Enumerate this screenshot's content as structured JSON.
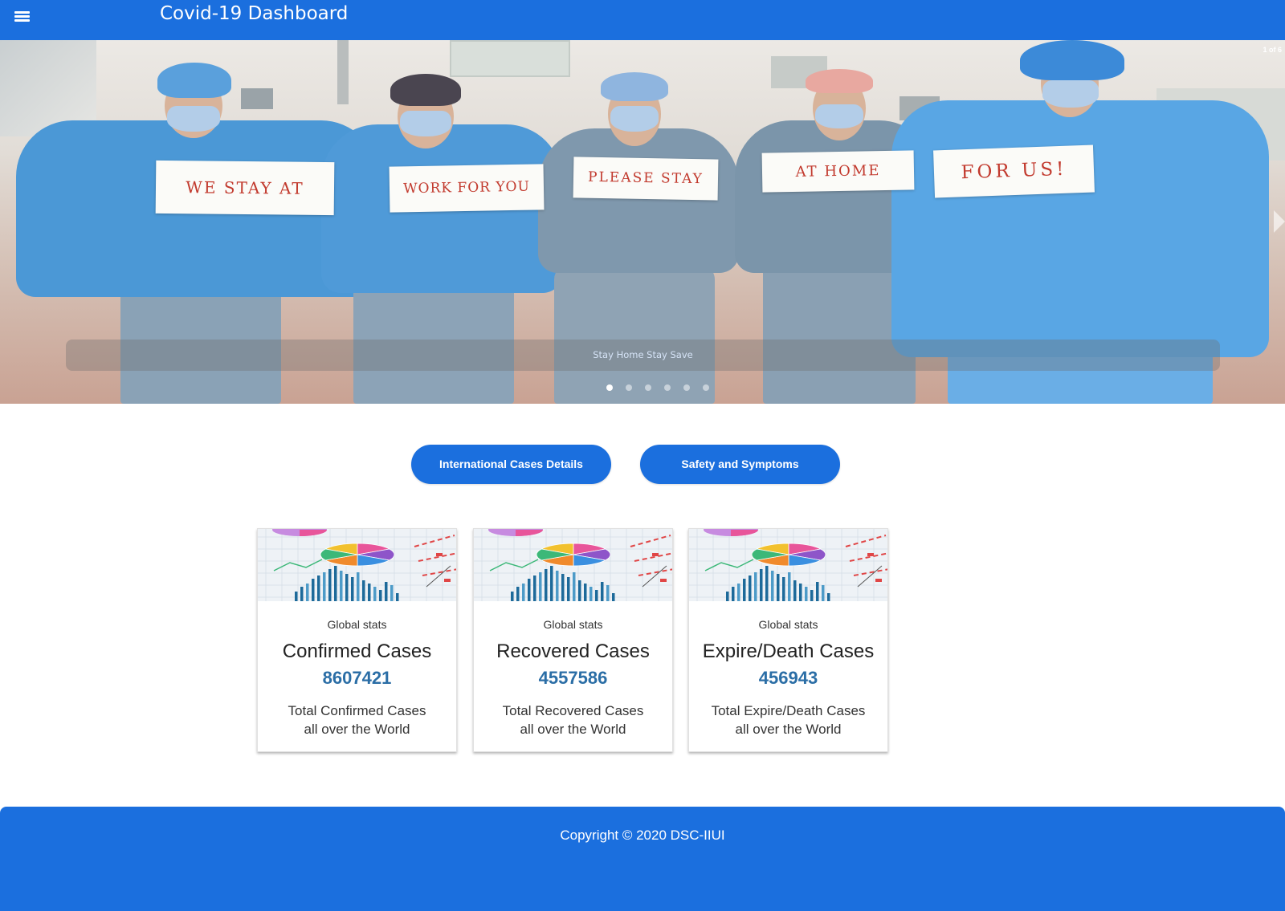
{
  "colors": {
    "primary": "#1b6fde",
    "stat_value": "#2b6ea6",
    "sign_ink": "#c23a2e"
  },
  "header": {
    "menu_icon": "menu-icon",
    "title": "Covid-19 Dashboard"
  },
  "carousel": {
    "counter": "1 of 6",
    "caption": "Stay Home Stay Save",
    "slide_count": 6,
    "active_slide": 1,
    "next_icon": "chevron-right-icon",
    "signs": [
      "WE STAY AT",
      "WORK FOR YOU",
      "PLEASE STAY",
      "AT HOME",
      "FOR US!"
    ]
  },
  "actions": [
    {
      "label": "International Cases Details"
    },
    {
      "label": "Safety and Symptoms"
    }
  ],
  "stats": [
    {
      "image_icon": "chart-thumbnail-image",
      "eyebrow": "Global stats",
      "title": "Confirmed Cases",
      "value": "8607421",
      "description": [
        "Total Confirmed Cases",
        "all over the World"
      ]
    },
    {
      "image_icon": "chart-thumbnail-image",
      "eyebrow": "Global stats",
      "title": "Recovered Cases",
      "value": "4557586",
      "description": [
        "Total Recovered Cases",
        "all over the World"
      ]
    },
    {
      "image_icon": "chart-thumbnail-image",
      "eyebrow": "Global stats",
      "title": "Expire/Death Cases",
      "value": "456943",
      "description": [
        "Total Expire/Death Cases",
        "all over the World"
      ]
    }
  ],
  "footer": {
    "copyright": "Copyright © 2020 DSC-IIUI"
  }
}
